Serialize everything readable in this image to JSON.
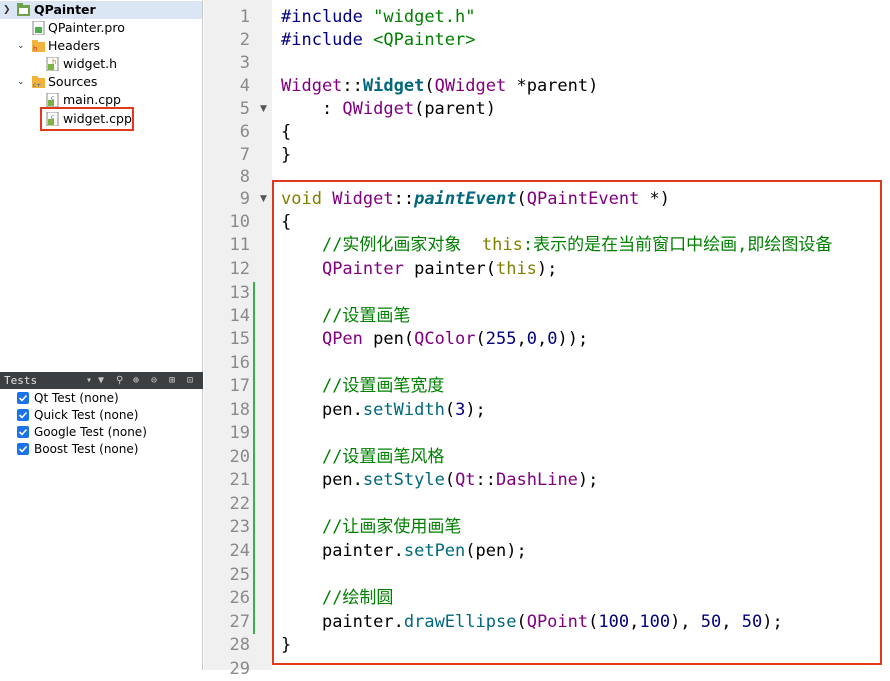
{
  "project": {
    "name": "QPainter",
    "pro_file": "QPainter.pro",
    "headers_label": "Headers",
    "header_file": "widget.h",
    "sources_label": "Sources",
    "source_main": "main.cpp",
    "source_widget": "widget.cpp"
  },
  "tests": {
    "title": "Tests",
    "items": [
      "Qt Test (none)",
      "Quick Test (none)",
      "Google Test (none)",
      "Boost Test (none)"
    ]
  },
  "editor": {
    "line_numbers": [
      "1",
      "2",
      "3",
      "4",
      "5",
      "6",
      "7",
      "8",
      "9",
      "10",
      "11",
      "12",
      "13",
      "14",
      "15",
      "16",
      "17",
      "18",
      "19",
      "20",
      "21",
      "22",
      "23",
      "24",
      "25",
      "26",
      "27",
      "28",
      "29"
    ],
    "code": {
      "include_kw": "#include",
      "inc1": "\"widget.h\"",
      "inc2": "<QPainter>",
      "cls": "Widget",
      "scope": "::",
      "ctor": "Widget",
      "qwidget": "QWidget",
      "star_parent": " *parent)",
      "colon": "    : ",
      "parent_call": "(parent)",
      "brace_open": "{",
      "brace_close": "}",
      "void": "void",
      "paint": "paintEvent",
      "qpaintevent": "QPaintEvent",
      "star_close": " *)",
      "c1a": "//实例化画家对象  ",
      "c1this": "this",
      "c1b": ":表示的是在当前窗口中绘画,即绘图设备",
      "qpainter": "QPainter",
      "painter_decl": " painter(",
      "this": "this",
      "close_semi": ");",
      "c2": "//设置画笔",
      "qpen": "QPen",
      "pen_decl": " pen(",
      "qcolor": "QColor",
      "n255": "255",
      "n0": "0",
      "comma": ",",
      "close2": "));",
      "c3": "//设置画笔宽度",
      "pen": "pen",
      "dot": ".",
      "setwidth": "setWidth",
      "n3": "3",
      "c4": "//设置画笔风格",
      "setstyle": "setStyle",
      "qt": "Qt",
      "dashline": "DashLine",
      "c5": "//让画家使用画笔",
      "painter": "painter",
      "setpen": "setPen",
      "pen_arg": "(pen);",
      "c6": "//绘制圆",
      "drawellipse": "drawEllipse",
      "qpoint": "QPoint",
      "n100": "100",
      "n50": "50",
      "comma_sp": ", ",
      "indent": "    ",
      "lparen": "(",
      "rparen": ")",
      "rparen_comma": "), "
    }
  },
  "colors": {
    "highlight": "#e03a1e",
    "change_bar": "#3fae4a",
    "selection": "#dbe6f4",
    "checkbox": "#1a73e8"
  }
}
